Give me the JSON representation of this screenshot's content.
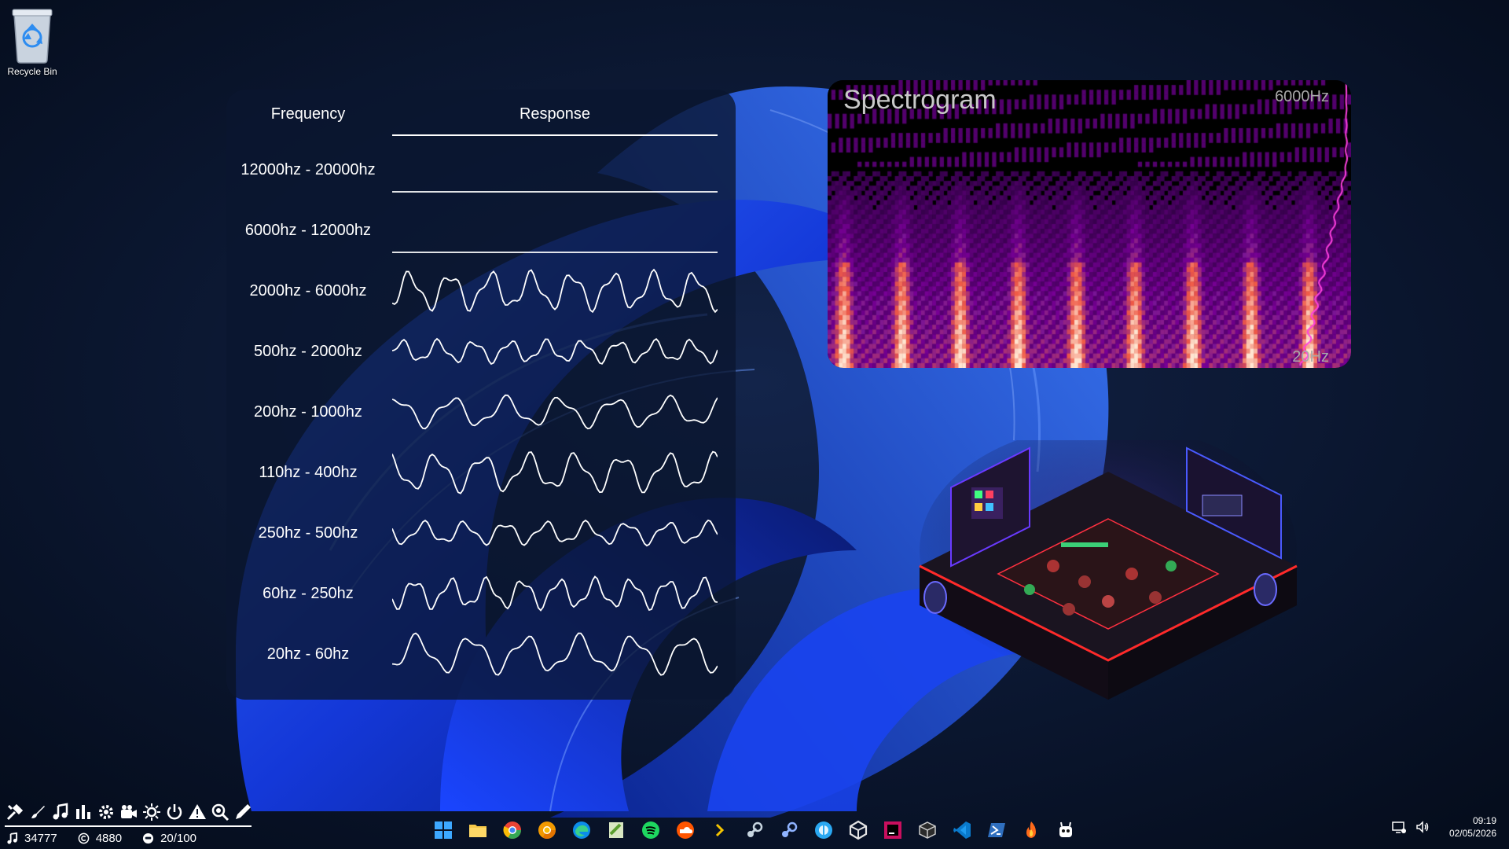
{
  "desktop": {
    "recycle_bin_label": "Recycle Bin"
  },
  "frequency_panel": {
    "header_frequency": "Frequency",
    "header_response": "Response",
    "bands": [
      {
        "label": "12000hz - 20000hz",
        "active": false
      },
      {
        "label": "6000hz - 12000hz",
        "active": false
      },
      {
        "label": "2000hz - 6000hz",
        "active": true
      },
      {
        "label": "500hz - 2000hz",
        "active": true
      },
      {
        "label": "200hz - 1000hz",
        "active": true
      },
      {
        "label": "110hz - 400hz",
        "active": true
      },
      {
        "label": "250hz - 500hz",
        "active": true
      },
      {
        "label": "60hz - 250hz",
        "active": true
      },
      {
        "label": "20hz - 60hz",
        "active": true
      }
    ]
  },
  "spectrogram": {
    "title": "Spectrogram",
    "top_label": "6000Hz",
    "bottom_label": "20Hz"
  },
  "toolbar": {
    "tools": [
      "tools-icon",
      "brush-icon",
      "music-note-icon",
      "bar-chart-icon",
      "gear-icon",
      "camera-icon",
      "sun-gear-icon",
      "power-icon",
      "warning-icon",
      "zoom-icon",
      "pen-icon"
    ],
    "stats": [
      {
        "icon": "music-note-icon",
        "value": "34777"
      },
      {
        "icon": "copyright-icon",
        "value": "4880"
      },
      {
        "icon": "face-icon",
        "value": "20/100"
      }
    ]
  },
  "taskbar": {
    "apps": [
      "start-icon",
      "file-explorer-icon",
      "chrome-icon",
      "chrome-canary-icon",
      "edge-icon",
      "notepad-plus-icon",
      "spotify-icon",
      "soundcloud-icon",
      "prompt-icon",
      "steam-icon",
      "steam-alt-icon",
      "arc-icon",
      "unity-icon",
      "rider-icon",
      "box-icon",
      "vscode-icon",
      "powershell-icon",
      "fire-icon",
      "bot-icon"
    ],
    "clock_time": "09:19",
    "clock_date": "02/05/2026"
  },
  "colors": {
    "accent_blue": "#1f4fff",
    "wave": "#ffffff",
    "spectrum_peak": "#ff40e0"
  }
}
